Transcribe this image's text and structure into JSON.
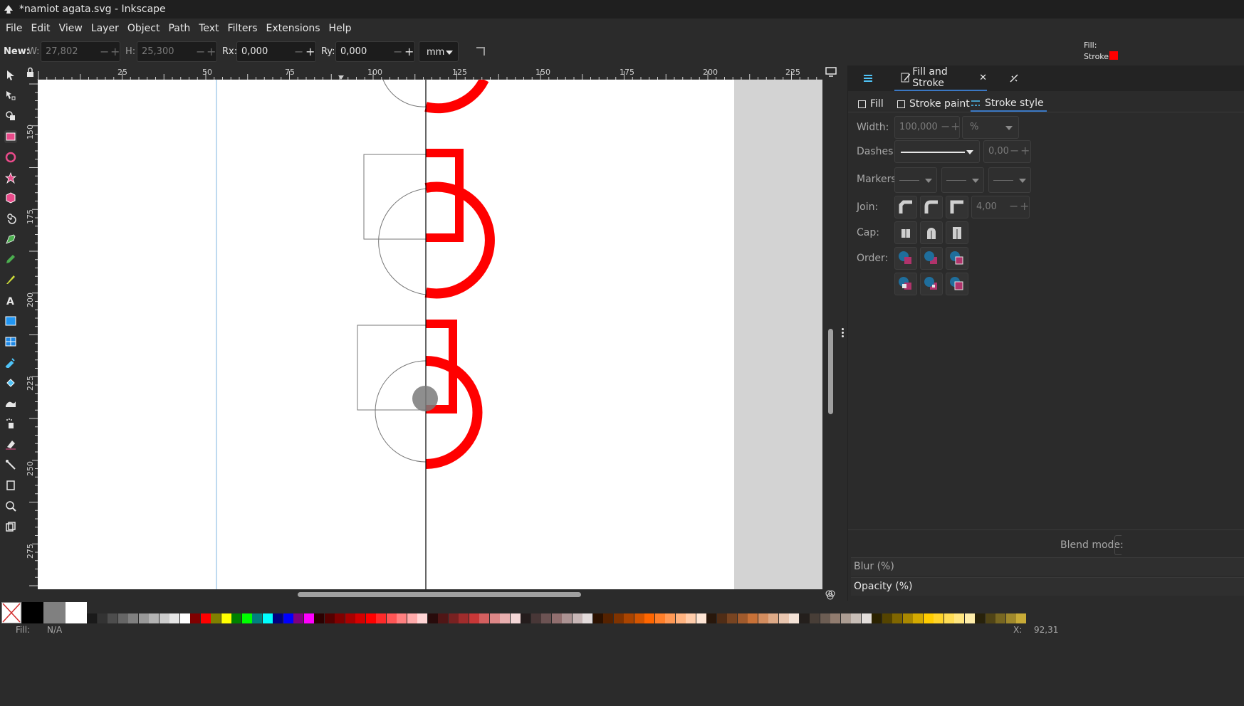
{
  "window": {
    "title": "*namiot agata.svg - Inkscape"
  },
  "menubar": [
    "File",
    "Edit",
    "View",
    "Layer",
    "Object",
    "Path",
    "Text",
    "Filters",
    "Extensions",
    "Help"
  ],
  "tool_controls": {
    "mode_label": "New:",
    "w_label": "W:",
    "w_value": "27,802",
    "h_label": "H:",
    "h_value": "25,300",
    "rx_label": "Rx:",
    "rx_value": "0,000",
    "ry_label": "Ry:",
    "ry_value": "0,000",
    "unit": "mm"
  },
  "fill_stroke_indicator": {
    "fill_label": "Fill:",
    "stroke_label": "Stroke:",
    "stroke_color": "#ff0000"
  },
  "rulers": {
    "horizontal_ticks": [
      "25",
      "50",
      "75",
      "100",
      "125",
      "150",
      "175",
      "200",
      "225"
    ],
    "vertical_ticks": [
      "150",
      "175",
      "200",
      "225",
      "250",
      "275"
    ]
  },
  "panel": {
    "tabs": [
      "Fill and Stroke"
    ],
    "close_icon": "close-icon",
    "sub_tabs": [
      "Fill",
      "Stroke paint",
      "Stroke style"
    ],
    "width_label": "Width:",
    "width_value": "100,000",
    "width_unit": "%",
    "dashes_label": "Dashes:",
    "dash_offset": "0,00",
    "markers_label": "Markers:",
    "join_label": "Join:",
    "miter_value": "4,00",
    "cap_label": "Cap:",
    "order_label": "Order:",
    "blend_label": "Blend mode:",
    "blur_label": "Blur (%)",
    "opacity_label": "Opacity (%)"
  },
  "status": {
    "fill_label": "Fill:",
    "fill_value": "N/A",
    "x_label": "X:",
    "x_value": "92,31"
  },
  "colors": {
    "accent": "#3b78c4",
    "shape_red": "#ff0000",
    "dark_bg": "#2b2b2b"
  }
}
